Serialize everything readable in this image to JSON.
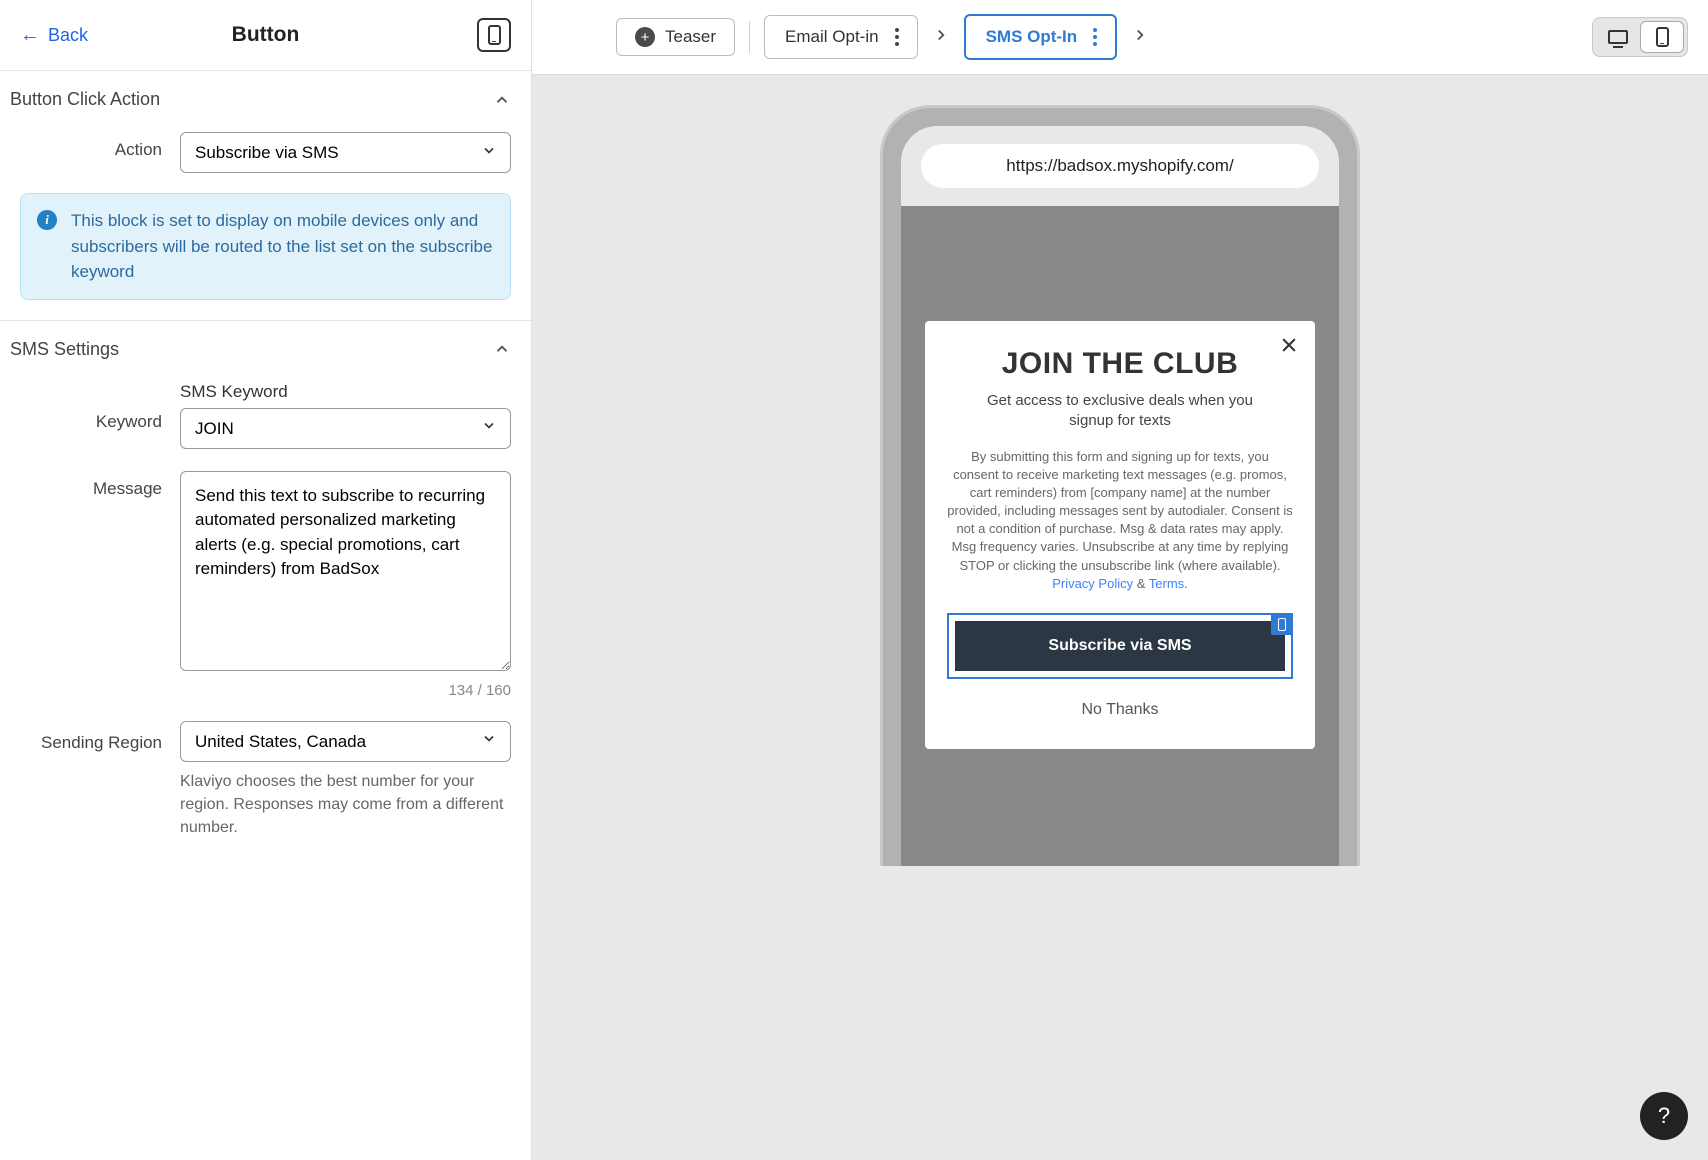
{
  "header": {
    "back": "Back",
    "title": "Button"
  },
  "topbar": {
    "teaser": "Teaser",
    "steps": [
      "Email Opt-in",
      "SMS Opt-In"
    ],
    "active_step_index": 1
  },
  "sections": {
    "click_action": {
      "title": "Button Click Action",
      "action_label": "Action",
      "action_value": "Subscribe via SMS",
      "info_text": "This block is set to display on mobile devices only and subscribers will be routed to the list set on the subscribe keyword"
    },
    "sms_settings": {
      "title": "SMS Settings",
      "keyword_label": "Keyword",
      "keyword_sublabel": "SMS Keyword",
      "keyword_value": "JOIN",
      "message_label": "Message",
      "message_value": "Send this text to subscribe to recurring automated personalized marketing alerts (e.g. special promotions, cart reminders) from BadSox",
      "char_count": "134 / 160",
      "region_label": "Sending Region",
      "region_value": "United States, Canada",
      "region_help": "Klaviyo chooses the best number for your region. Responses may come from a different number."
    }
  },
  "preview": {
    "url": "https://badsox.myshopify.com/",
    "popup": {
      "title": "JOIN THE CLUB",
      "subtitle": "Get access to exclusive deals when you signup for texts",
      "legal_1": "By submitting this form and signing up for texts, you consent to receive marketing text messages (e.g. promos, cart reminders) from [company name] at the number provided, including messages sent by autodialer. Consent is not a condition of purchase. Msg & data rates may apply. Msg frequency varies. Unsubscribe at any time by replying STOP or clicking the unsubscribe link (where available). ",
      "privacy": "Privacy Policy",
      "and": " & ",
      "terms": "Terms",
      "cta": "Subscribe via SMS",
      "decline": "No Thanks"
    }
  },
  "help": "?"
}
